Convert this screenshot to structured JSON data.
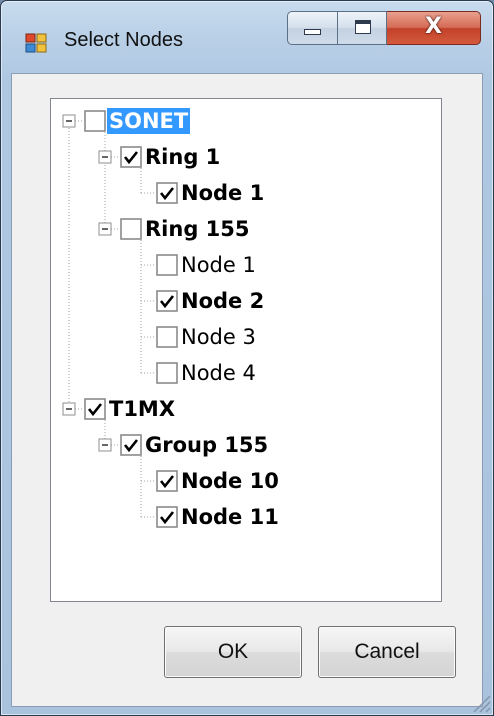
{
  "window": {
    "title": "Select Nodes",
    "icon": "window-app-icon",
    "caption_buttons": [
      "minimize-icon",
      "maximize-icon",
      "close-icon"
    ]
  },
  "tree": [
    {
      "label": "SONET",
      "checked": false,
      "bold": true,
      "selected": true,
      "expanded": true,
      "children": [
        {
          "label": "Ring 1",
          "checked": true,
          "bold": true,
          "expanded": true,
          "children": [
            {
              "label": "Node 1",
              "checked": true,
              "bold": true
            }
          ]
        },
        {
          "label": "Ring 155",
          "checked": false,
          "bold": true,
          "expanded": true,
          "children": [
            {
              "label": "Node 1",
              "checked": false,
              "bold": false
            },
            {
              "label": "Node 2",
              "checked": true,
              "bold": true
            },
            {
              "label": "Node 3",
              "checked": false,
              "bold": false
            },
            {
              "label": "Node 4",
              "checked": false,
              "bold": false
            }
          ]
        }
      ]
    },
    {
      "label": "T1MX",
      "checked": true,
      "bold": true,
      "expanded": true,
      "children": [
        {
          "label": "Group 155",
          "checked": true,
          "bold": true,
          "expanded": true,
          "children": [
            {
              "label": "Node 10",
              "checked": true,
              "bold": true
            },
            {
              "label": "Node 11",
              "checked": true,
              "bold": true
            }
          ]
        }
      ]
    }
  ],
  "buttons": {
    "ok": "OK",
    "cancel": "Cancel"
  },
  "colors": {
    "selection": "#3399ff",
    "tree_lines": "#a0a0a0",
    "check_mark": "#000000"
  }
}
